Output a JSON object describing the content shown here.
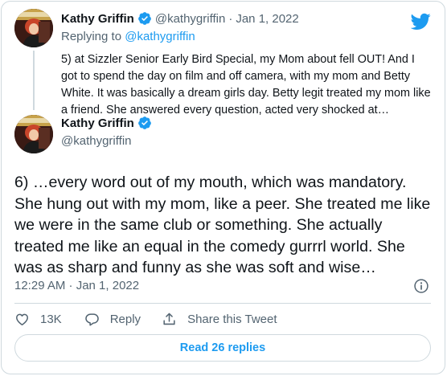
{
  "colors": {
    "accent": "#1d9bf0",
    "text_primary": "#0f1419",
    "text_secondary": "#536471",
    "border": "#cfd9de"
  },
  "icons": {
    "logo": "twitter-bird-icon",
    "verified": "verified-badge-icon",
    "info": "info-icon",
    "like": "heart-icon",
    "reply": "speech-bubble-icon",
    "share": "share-icon"
  },
  "parent_tweet": {
    "author_name": "Kathy Griffin",
    "author_handle": "@kathygriffin",
    "separator": "·",
    "date": "Jan 1, 2022",
    "replying_prefix": "Replying to",
    "replying_to": "@kathygriffin",
    "text": "5) at Sizzler Senior Early Bird Special, my Mom about fell OUT! And I got to spend the day on film and off camera, with my mom and Betty White. It was basically a dream girls day. Betty legit treated my mom like a friend. She answered every question, acted very shocked at…"
  },
  "main_tweet": {
    "author_name": "Kathy Griffin",
    "author_handle": "@kathygriffin",
    "text": "6) …every word out of my mouth, which was mandatory. She hung out with my mom, like a peer. She treated me like we were in the same club or something. She actually treated me like an equal in the comedy gurrrl world. She was as sharp and funny as she was soft and wise…",
    "timestamp": "12:29 AM · Jan 1, 2022"
  },
  "actions": {
    "like_count": "13K",
    "reply_label": "Reply",
    "share_label": "Share this Tweet"
  },
  "read_replies_label": "Read 26 replies"
}
